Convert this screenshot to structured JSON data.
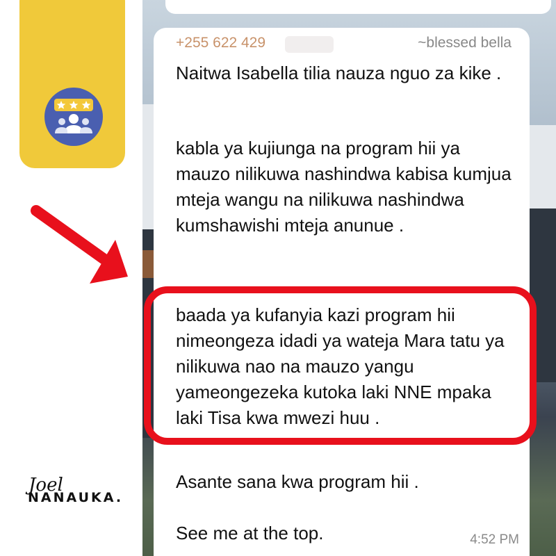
{
  "sidebar": {
    "icon": "rating-stars-group-icon"
  },
  "message": {
    "sender_phone": "+255 622 429",
    "sender_name": "~blessed bella",
    "paragraphs": [
      "Naitwa Isabella tilia nauza nguo za kike .",
      "kabla ya kujiunga na program hii ya mauzo nilikuwa nashindwa kabisa kumjua mteja  wangu na nilikuwa nashindwa kumshawishi mteja anunue .",
      "baada ya kufanyia kazi program hii nimeongeza idadi ya wateja Mara tatu ya nilikuwa nao na mauzo yangu yameongezeka kutoka laki NNE mpaka laki Tisa kwa mwezi huu .",
      "Asante sana kwa program hii .",
      "See me at the top."
    ],
    "timestamp": "4:52 PM"
  },
  "annotation": {
    "arrow_color": "#e8101c",
    "highlight_color": "#e8101c"
  },
  "watermark": {
    "signature": "Joel",
    "brand": "NANAUKA."
  },
  "colors": {
    "card_yellow": "#f0c93a",
    "icon_blue": "#4a5fb0",
    "sender_phone": "#c8926a"
  }
}
